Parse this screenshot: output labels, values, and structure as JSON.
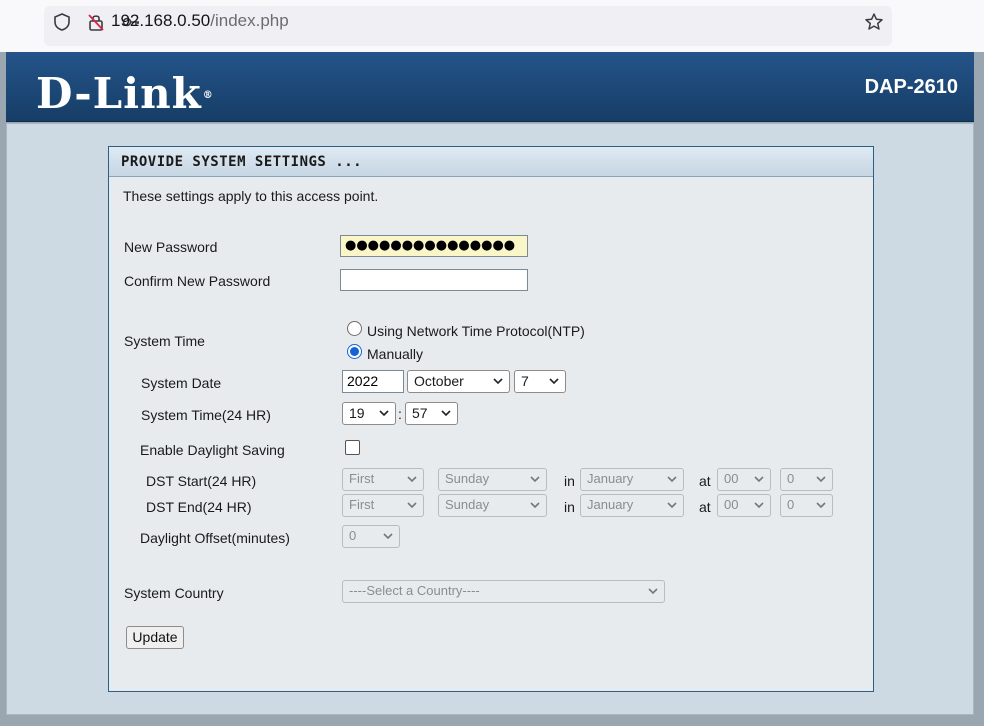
{
  "browser": {
    "url_host": "192.168.0.50",
    "url_path": "/index.php",
    "icons": [
      "shield-icon",
      "lock-crossed-icon",
      "key-icon",
      "star-icon"
    ]
  },
  "header": {
    "logo": "D-Link",
    "logo_mark": "®",
    "model": "DAP-2610"
  },
  "panel": {
    "title": "PROVIDE SYSTEM SETTINGS ...",
    "intro": "These settings apply to this access point."
  },
  "form": {
    "new_password_label": "New Password",
    "new_password_value": "●●●●●●●●●●●●●●●",
    "confirm_password_label": "Confirm New Password",
    "confirm_password_value": "",
    "system_time_label": "System Time",
    "ntp_label": "Using Network Time Protocol(NTP)",
    "manual_label": "Manually",
    "time_mode": "manual",
    "system_date_label": "System Date",
    "year": "2022",
    "month": "October",
    "day": "7",
    "system_time_24_label": "System Time(24 HR)",
    "hour": "19",
    "time_sep": ":",
    "minute": "57",
    "daylight_label": "Enable Daylight Saving",
    "daylight_enabled": false,
    "dst_start_label": "DST Start(24 HR)",
    "dst_end_label": "DST End(24 HR)",
    "dst_start": {
      "week": "First",
      "weekday": "Sunday",
      "in": "in",
      "month": "January",
      "at": "at",
      "hour": "00",
      "minute": "0"
    },
    "dst_end": {
      "week": "First",
      "weekday": "Sunday",
      "in": "in",
      "month": "January",
      "at": "at",
      "hour": "00",
      "minute": "0"
    },
    "offset_label": "Daylight Offset(minutes)",
    "offset_value": "0",
    "country_label": "System Country",
    "country_value": "----Select a Country----",
    "update_label": "Update"
  },
  "colors": {
    "header_bg": "#1d4a7a",
    "content_bg": "#cdd9e3",
    "panel_border": "#2c5f86",
    "radio_accent": "#1563d6"
  }
}
